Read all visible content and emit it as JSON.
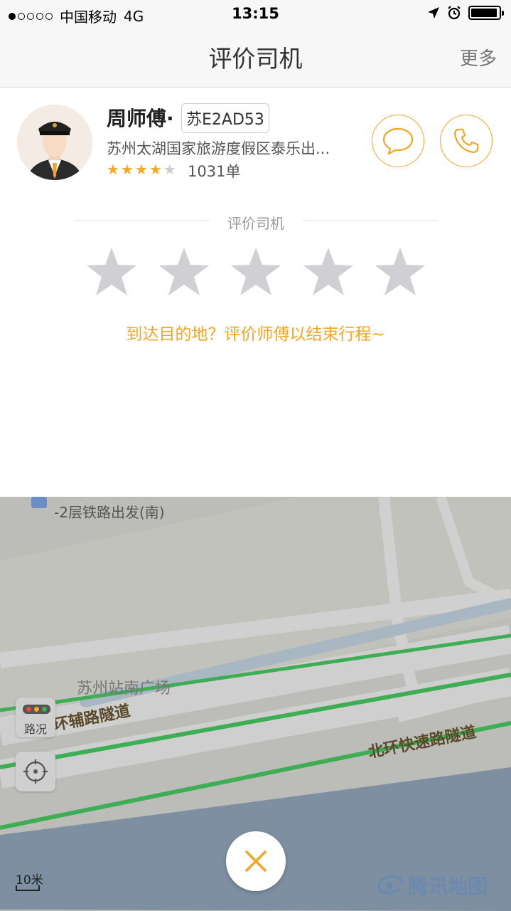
{
  "status_bar": {
    "carrier": "中国移动",
    "network": "4G",
    "time": "13:15"
  },
  "nav": {
    "title": "评价司机",
    "more": "更多"
  },
  "driver": {
    "name": "周师傅·",
    "plate": "苏E2AD53",
    "company": "苏州太湖国家旅游度假区泰乐出...",
    "rating_stars": 4,
    "rating_max": 5,
    "orders": "1031单"
  },
  "rate_section": {
    "divider_label": "评价司机",
    "star_count": 5,
    "hint": "到达目的地？评价师傅以结束行程~"
  },
  "map": {
    "poi_label": "-2层铁路出发(南)",
    "place_label": "苏州站南广场",
    "road_1": "北环辅路隧道",
    "road_2": "北环快速路隧道",
    "traffic_label": "路况",
    "scale": "10米",
    "logo": "腾讯地图"
  },
  "colors": {
    "accent": "#f5a623",
    "star_empty": "#cfcfd4",
    "route_green": "#3dae54"
  },
  "icons": [
    "message-icon",
    "phone-icon",
    "locate-icon",
    "close-icon",
    "traffic-light-icon",
    "location-arrow-icon",
    "alarm-icon",
    "battery-icon"
  ]
}
